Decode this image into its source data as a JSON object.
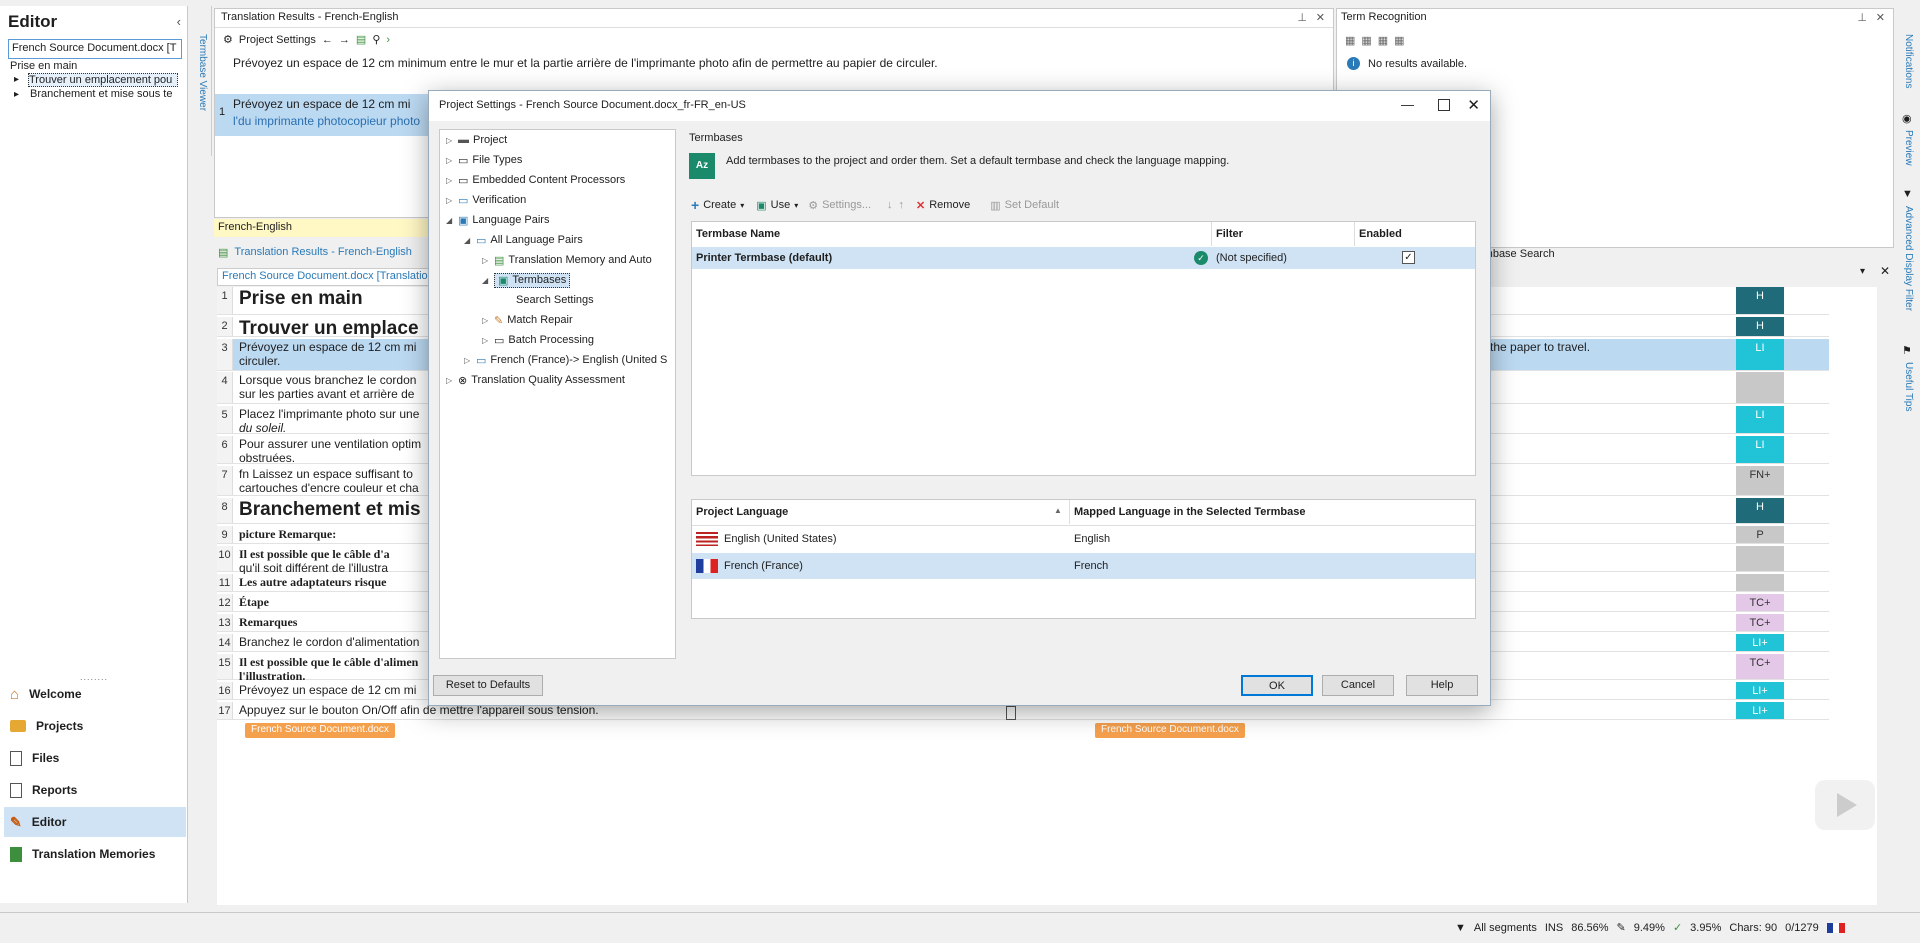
{
  "editor_panel": {
    "title": "Editor",
    "tree": {
      "root": "French Source Document.docx [T",
      "items": [
        "Prise en main",
        "Trouver un emplacement pou",
        "Branchement et mise sous te"
      ]
    },
    "nav": [
      "Welcome",
      "Projects",
      "Files",
      "Reports",
      "Editor",
      "Translation Memories"
    ]
  },
  "translation_results": {
    "title": "Translation Results - French-English",
    "project_settings": "Project Settings",
    "source_text": "Prévoyez un espace de 12 cm minimum entre le mur et la partie arrière de l'imprimante photo afin de permettre au papier de circuler.",
    "row_num": "1",
    "row_text1": "Prévoyez un espace de 12 cm mi",
    "row_text2": "l'du imprimante photocopieur photo"
  },
  "term_recognition": {
    "title": "Term Recognition",
    "no_results": "No results available."
  },
  "side_tabs": {
    "termbase_viewer": "Termbase Viewer",
    "notifications": "Notifications",
    "preview": "Preview",
    "advanced_filter": "Advanced Display Filter",
    "useful_tips": "Useful Tips"
  },
  "editor_area": {
    "language_pair": "French-English",
    "tab_results": "Translation Results - French-English",
    "doc_tab": "French Source Document.docx [Translatio",
    "termbase_search": "rmbase Search",
    "right_seg3": "the paper to travel.",
    "doc_footer": "French Source Document.docx",
    "segments": [
      {
        "n": "1",
        "t": "Prise en main",
        "tag": "H"
      },
      {
        "n": "2",
        "t": "Trouver un emplace",
        "tag": "H"
      },
      {
        "n": "3",
        "t": "Prévoyez un espace de 12 cm mi",
        "t2": "circuler.",
        "tag": "LI"
      },
      {
        "n": "4",
        "t": "Lorsque vous branchez le cordon",
        "t2": "sur les parties avant et arrière de",
        "tag": ""
      },
      {
        "n": "5",
        "t": "Placez l'imprimante photo sur une",
        "t2": "du soleil.",
        "tag": "LI"
      },
      {
        "n": "6",
        "t": "Pour assurer une ventilation optim",
        "t2": "obstruées.",
        "tag": "LI"
      },
      {
        "n": "7",
        "t": "fn Laissez un espace suffisant to",
        "t2": "cartouches d'encre couleur et cha",
        "tag": "FN+"
      },
      {
        "n": "8",
        "t": "Branchement et mis",
        "tag": "H"
      },
      {
        "n": "9",
        "t": "picture Remarque:",
        "tag": "P"
      },
      {
        "n": "10",
        "t": "Il est possible que le câble d'a",
        "t2": "qu'il soit différent de l'illustra",
        "tag": ""
      },
      {
        "n": "11",
        "t": "Les autre adaptateurs risque",
        "tag": ""
      },
      {
        "n": "12",
        "t": "Étape",
        "tag": "TC+"
      },
      {
        "n": "13",
        "t": "Remarques",
        "tag": "TC+"
      },
      {
        "n": "14",
        "t": "Branchez le cordon d'alimentation",
        "tag": "LI+"
      },
      {
        "n": "15",
        "t": "Il est possible que le câble d'alimen",
        "t2": "l'illustration.",
        "tag": "TC+"
      },
      {
        "n": "16",
        "t": "Prévoyez un espace de 12 cm mi",
        "tag": "LI+"
      },
      {
        "n": "17",
        "t": "Appuyez sur le bouton On/Off afin de mettre l'appareil sous tension.",
        "tag": "LI+"
      }
    ]
  },
  "dialog": {
    "title": "Project Settings - French Source Document.docx_fr-FR_en-US",
    "tree": [
      "Project",
      "File Types",
      "Embedded Content Processors",
      "Verification",
      "Language Pairs",
      "All Language Pairs",
      "Translation Memory and Auto",
      "Termbases",
      "Search Settings",
      "Match Repair",
      "Batch Processing",
      "French (France)-> English (United S",
      "Translation Quality Assessment"
    ],
    "section": "Termbases",
    "description": "Add termbases to the project and order them. Set a default termbase and check the language mapping.",
    "toolbar": {
      "create": "Create",
      "use": "Use",
      "settings": "Settings...",
      "remove": "Remove",
      "set_default": "Set Default"
    },
    "termbase_table": {
      "headers": [
        "Termbase Name",
        "Filter",
        "Enabled"
      ],
      "rows": [
        {
          "name": "Printer Termbase (default)",
          "filter": "(Not specified)",
          "enabled": "✓"
        }
      ]
    },
    "lang_table": {
      "headers": [
        "Project Language",
        "Mapped Language in the Selected Termbase"
      ],
      "rows": [
        {
          "lang": "English (United States)",
          "mapped": "English"
        },
        {
          "lang": "French (France)",
          "mapped": "French"
        }
      ]
    },
    "buttons": {
      "reset": "Reset to Defaults",
      "ok": "OK",
      "cancel": "Cancel",
      "help": "Help"
    }
  },
  "status_bar": {
    "segments": "All segments",
    "ins": "INS",
    "p1": "86.56%",
    "p2": "9.49%",
    "p3": "3.95%",
    "chars": "Chars: 90",
    "count": "0/1279"
  }
}
